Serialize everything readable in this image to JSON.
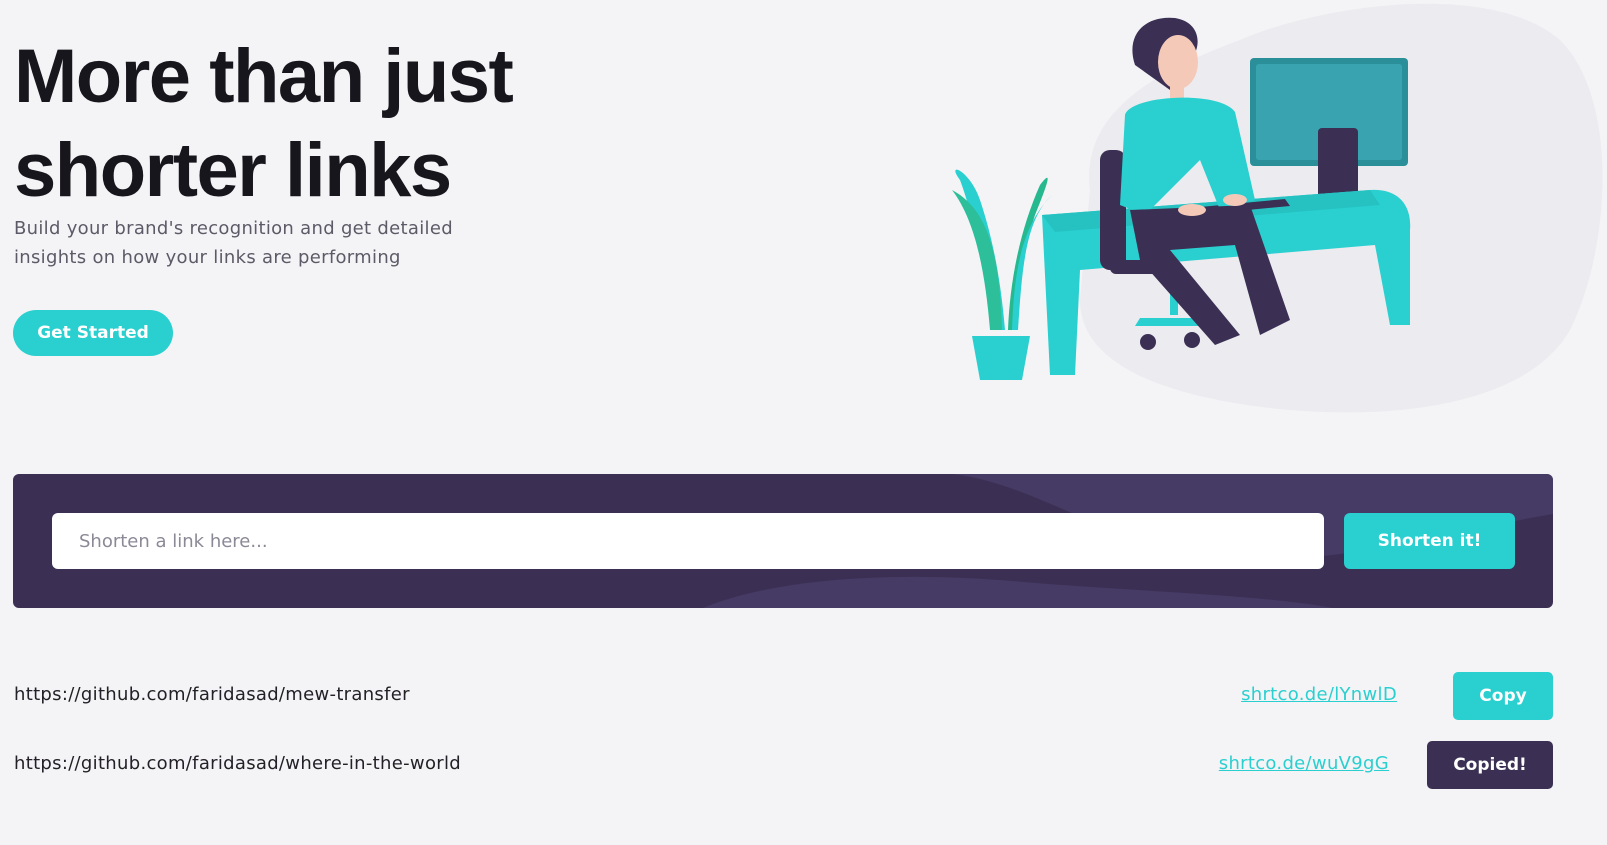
{
  "hero": {
    "title_line1": "More than just",
    "title_line2": "shorter links",
    "subtitle_line1": "Build your brand's recognition and get detailed",
    "subtitle_line2": "insights on how your links are performing",
    "cta_label": "Get Started"
  },
  "illustration": {
    "icon": "person-working-at-desk-illustration"
  },
  "shortener": {
    "placeholder": "Shorten a link here...",
    "button_label": "Shorten it!"
  },
  "results": [
    {
      "original": "https://github.com/faridasad/mew-transfer",
      "short": "shrtco.de/lYnwlD",
      "button_label": "Copy"
    },
    {
      "original": "https://github.com/faridasad/where-in-the-world",
      "short": "shrtco.de/wuV9gG",
      "button_label": "Copied!"
    }
  ],
  "colors": {
    "accent": "#2acfcf",
    "dark_violet": "#3b3054",
    "text_dark": "#17161c",
    "text_muted": "#5d5a67"
  }
}
